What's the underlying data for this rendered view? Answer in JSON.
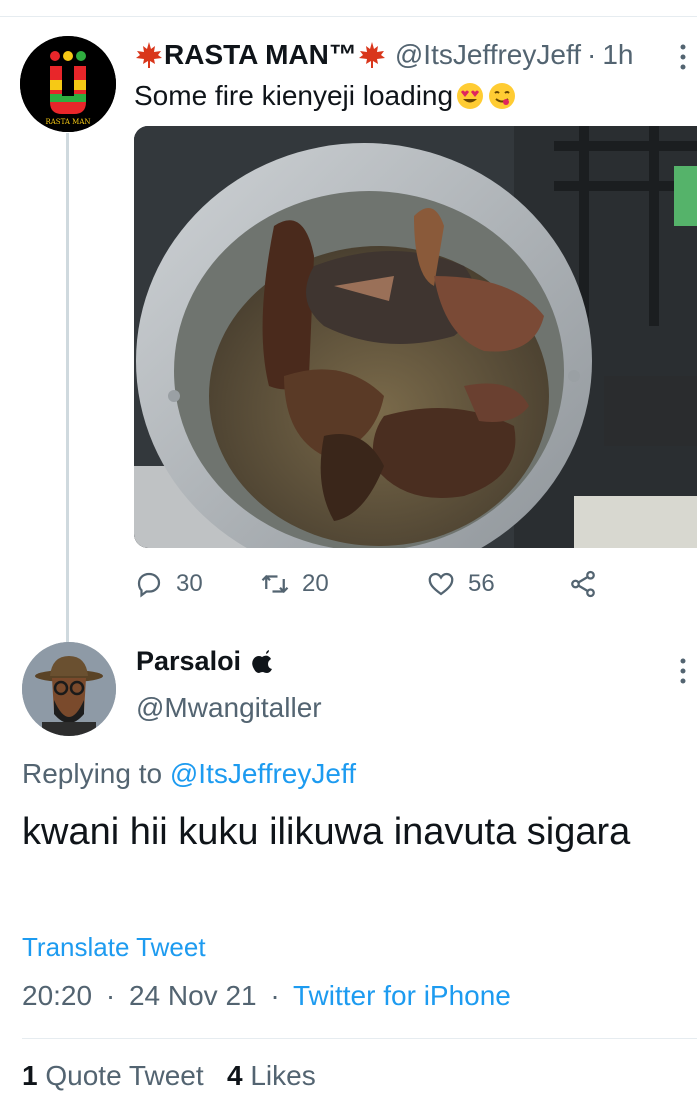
{
  "tweet1": {
    "display_name": "RASTA MAN™",
    "handle": "@ItsJeffreyJeff",
    "separator": "·",
    "time": "1h",
    "text": "Some fire kienyeji loading",
    "avatar_logo_text": "RASTA MAN",
    "stats": {
      "replies": "30",
      "retweets": "20",
      "likes": "56"
    }
  },
  "tweet2": {
    "display_name": "Parsaloi",
    "handle": "@Mwangitaller",
    "replying_prefix": "Replying to ",
    "replying_to": "@ItsJeffreyJeff",
    "text": "kwani hii kuku ilikuwa inavuta sigara",
    "translate_label": "Translate Tweet",
    "time": "20:20",
    "date": "24 Nov 21",
    "separator": "·",
    "source": "Twitter for iPhone",
    "quote_count": "1",
    "quote_label": "Quote Tweet",
    "likes_count": "4",
    "likes_label": "Likes"
  },
  "colors": {
    "link": "#1d9bf0",
    "secondary": "#536471",
    "primary_text": "#0f1419",
    "divider": "#e6ecf0"
  },
  "icons": [
    "maple-leaf-icon",
    "heart-eyes-emoji",
    "yum-emoji",
    "reply-icon",
    "retweet-icon",
    "like-icon",
    "share-icon",
    "more-icon",
    "apple-logo-icon"
  ]
}
